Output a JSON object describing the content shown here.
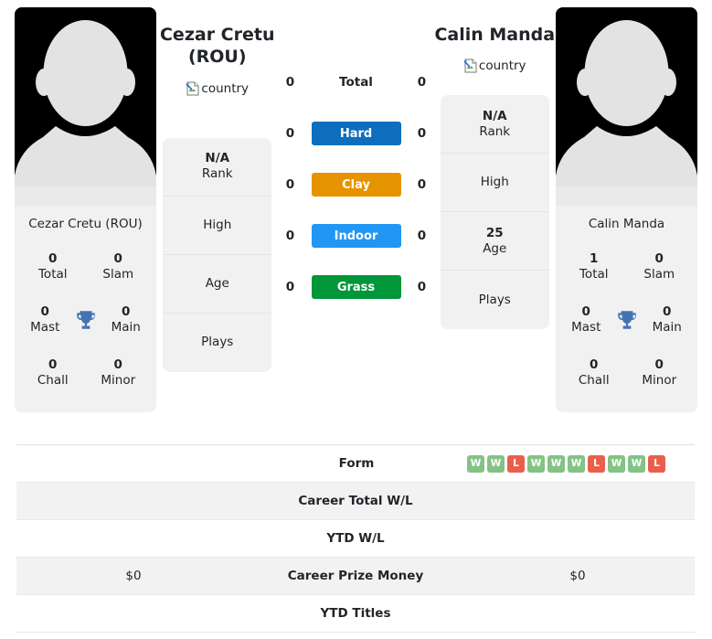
{
  "players": {
    "left": {
      "title": "Cezar Cretu\n(ROU)",
      "title_line1": "Cezar Cretu",
      "title_line2": "(ROU)",
      "flag_alt": "country",
      "card_name": "Cezar Cretu (ROU)",
      "titles": [
        {
          "value": "0",
          "label": "Total"
        },
        {
          "value": "0",
          "label": "Slam"
        },
        {
          "value": "0",
          "label": "Mast"
        },
        {
          "value": "0",
          "label": "Main"
        },
        {
          "value": "0",
          "label": "Chall"
        },
        {
          "value": "0",
          "label": "Minor"
        }
      ],
      "rank_rows": [
        {
          "value": "N/A",
          "label": "Rank"
        },
        {
          "value": "",
          "label": "High"
        },
        {
          "value": "",
          "label": "Age"
        },
        {
          "value": "",
          "label": "Plays"
        }
      ],
      "surface_counts": {
        "total": "0",
        "hard": "0",
        "clay": "0",
        "indoor": "0",
        "grass": "0"
      },
      "prize_money": "$0"
    },
    "right": {
      "title_line1": "Calin Manda",
      "title_line2": "",
      "flag_alt": "country",
      "card_name": "Calin Manda",
      "titles": [
        {
          "value": "1",
          "label": "Total"
        },
        {
          "value": "0",
          "label": "Slam"
        },
        {
          "value": "0",
          "label": "Mast"
        },
        {
          "value": "0",
          "label": "Main"
        },
        {
          "value": "0",
          "label": "Chall"
        },
        {
          "value": "0",
          "label": "Minor"
        }
      ],
      "rank_rows": [
        {
          "value": "N/A",
          "label": "Rank"
        },
        {
          "value": "",
          "label": "High"
        },
        {
          "value": "25",
          "label": "Age"
        },
        {
          "value": "",
          "label": "Plays"
        }
      ],
      "surface_counts": {
        "total": "0",
        "hard": "0",
        "clay": "0",
        "indoor": "0",
        "grass": "0"
      },
      "prize_money": "$0"
    }
  },
  "surfaces": [
    {
      "key": "total",
      "label": "Total",
      "pill": false,
      "color": ""
    },
    {
      "key": "hard",
      "label": "Hard",
      "pill": true,
      "color": "#0d6ebd"
    },
    {
      "key": "clay",
      "label": "Clay",
      "pill": true,
      "color": "#e59400"
    },
    {
      "key": "indoor",
      "label": "Indoor",
      "pill": true,
      "color": "#2196f3"
    },
    {
      "key": "grass",
      "label": "Grass",
      "pill": true,
      "color": "#009639"
    }
  ],
  "table": {
    "rows": [
      {
        "label": "Form",
        "left": "",
        "right": "",
        "type": "form"
      },
      {
        "label": "Career Total W/L",
        "left": "",
        "right": "",
        "type": "text"
      },
      {
        "label": "YTD W/L",
        "left": "",
        "right": "",
        "type": "text"
      },
      {
        "label": "Career Prize Money",
        "left": "$0",
        "right": "$0",
        "type": "text"
      },
      {
        "label": "YTD Titles",
        "left": "",
        "right": "",
        "type": "text"
      }
    ],
    "form_right": [
      "W",
      "W",
      "L",
      "W",
      "W",
      "W",
      "L",
      "W",
      "W",
      "L"
    ],
    "form_left": []
  },
  "colors": {
    "badge_win": "#84c286",
    "badge_loss": "#e8604c",
    "trophy": "#4472b5",
    "card_bg": "#f1f1f1",
    "row_alt": "#f2f2f2"
  },
  "icons": {
    "trophy": "trophy-icon",
    "broken_image": "broken-image-icon"
  }
}
